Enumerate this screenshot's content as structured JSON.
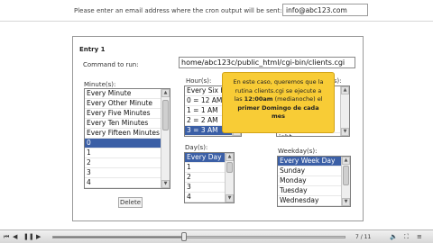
{
  "header": {
    "email_prompt": "Please enter an email address where the cron output will be sent:",
    "email_value": "info@abc123.com"
  },
  "entry": {
    "title": "Entry 1",
    "command_label": "Command to run:",
    "command_value": "home/abc123c/public_html/cgi-bin/clients.cgi"
  },
  "minutes": {
    "label": "Minute(s):",
    "options": [
      "Every Minute",
      "Every Other Minute",
      "Every Five Minutes",
      "Every Ten Minutes",
      "Every Fifteen Minutes",
      "0",
      "1",
      "2",
      "3",
      "4"
    ],
    "selected_index": 5
  },
  "hours": {
    "label": "Hour(s):",
    "options": [
      "Every Six H",
      "0 = 12 AM/M",
      "1 = 1 AM",
      "2 = 2 AM",
      "3 = 3 AM"
    ],
    "selected_index": 4
  },
  "right_peek": {
    "label": "(s):",
    "visible_option": "ight"
  },
  "days": {
    "label": "Day(s):",
    "options": [
      "Every Day",
      "1",
      "2",
      "3",
      "4"
    ],
    "selected_index": 0
  },
  "weekdays": {
    "label": "Weekday(s):",
    "options": [
      "Every Week Day",
      "Sunday",
      "Monday",
      "Tuesday",
      "Wednesday"
    ],
    "selected_index": 0
  },
  "delete_label": "Delete",
  "tooltip": {
    "line1": "En este caso, queremos que la",
    "line2": "rutina clients.cgi se ejecute a",
    "line3_pre": "las ",
    "line3_bold": "12:00am",
    "line3_post": " (medianoche) el",
    "line4": "primer Domingo de cada",
    "line5": "mes"
  },
  "player": {
    "progress": 0.45,
    "page_counter": "7 / 11",
    "accent": "#3b5fa6",
    "tooltip_color": "#f8cc36"
  }
}
